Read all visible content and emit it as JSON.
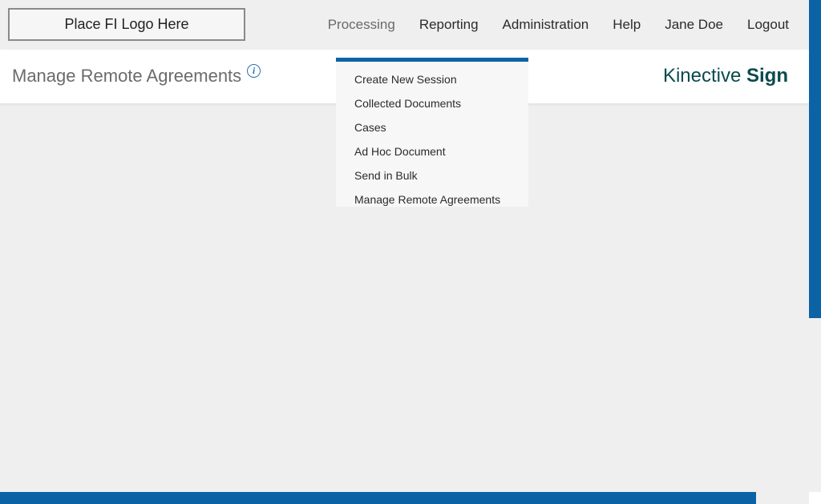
{
  "header": {
    "logo_placeholder": "Place FI Logo Here",
    "nav": {
      "processing": "Processing",
      "reporting": "Reporting",
      "administration": "Administration",
      "help": "Help",
      "user": "Jane Doe",
      "logout": "Logout"
    }
  },
  "subheader": {
    "page_title": "Manage Remote Agreements",
    "info_icon_glyph": "i",
    "brand_light": "Kinective",
    "brand_bold": "Sign"
  },
  "processing_menu": {
    "items": [
      "Create New Session",
      "Collected Documents",
      "Cases",
      "Ad Hoc Document",
      "Send in Bulk",
      "Manage Remote Agreements"
    ]
  },
  "colors": {
    "accent_blue": "#0b63a6",
    "brand_teal": "#0b4a4e",
    "background": "#efefef"
  }
}
